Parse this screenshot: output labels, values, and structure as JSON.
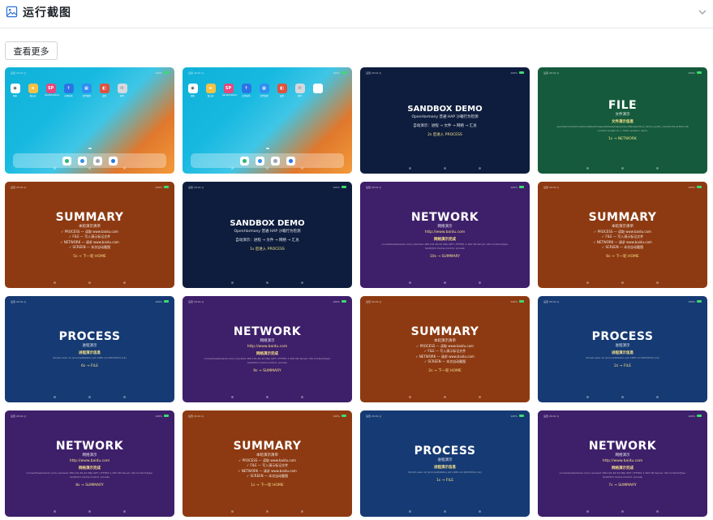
{
  "header": {
    "title": "运行截图",
    "icon": "image-icon",
    "collapse_icon": "chevron-down-icon"
  },
  "more_button": "查看更多",
  "status_bar": {
    "left": "设置 20:41 ◎",
    "right": "100%"
  },
  "desktop": {
    "apps": [
      {
        "label": "相机",
        "color": "#ffffff",
        "glyph": "◉",
        "glyph_color": "#444444"
      },
      {
        "label": "备忘录",
        "color": "#f6c143",
        "glyph": "≡",
        "glyph_color": "#ffffff"
      },
      {
        "label": "SandboxDemo",
        "color": "#e8467c",
        "glyph": "SP",
        "glyph_color": "#ffffff"
      },
      {
        "label": "应用市场",
        "color": "#2b74e6",
        "glyph": "↑",
        "glyph_color": "#ffffff"
      },
      {
        "label": "文件管理",
        "color": "#2f8ef0",
        "glyph": "▦",
        "glyph_color": "#ffffff"
      },
      {
        "label": "设置",
        "color": "#e0523e",
        "glyph": "◧",
        "glyph_color": "#ffffff"
      },
      {
        "label": "邮件",
        "color": "#d6d9de",
        "glyph": "✉",
        "glyph_color": "#7a7f87"
      }
    ],
    "apps_2": [
      {
        "label": "相机",
        "color": "#ffffff",
        "glyph": "◉",
        "glyph_color": "#444444"
      },
      {
        "label": "备忘录",
        "color": "#f6c143",
        "glyph": "≡",
        "glyph_color": "#ffffff"
      },
      {
        "label": "SandboxDemo",
        "color": "#e8467c",
        "glyph": "SP",
        "glyph_color": "#ffffff"
      },
      {
        "label": "应用市场",
        "color": "#2b74e6",
        "glyph": "↑",
        "glyph_color": "#ffffff"
      },
      {
        "label": "文件管理",
        "color": "#2f8ef0",
        "glyph": "▦",
        "glyph_color": "#ffffff"
      },
      {
        "label": "设置",
        "color": "#e0523e",
        "glyph": "◧",
        "glyph_color": "#ffffff"
      },
      {
        "label": "邮件",
        "color": "#d6d9de",
        "glyph": "✉",
        "glyph_color": "#7a7f87"
      },
      {
        "label": "",
        "color": "#ffffff",
        "glyph": "",
        "glyph_color": "#ffffff"
      }
    ],
    "dock": [
      "#2bb673",
      "#2f8ef0",
      "#9aa3ad",
      "#2b74e6"
    ]
  },
  "screenshots": [
    {
      "kind": "desktop",
      "apps_key": "apps"
    },
    {
      "kind": "desktop",
      "apps_key": "apps_2"
    },
    {
      "kind": "sandbox",
      "color": "c-navy",
      "title": "SANDBOX DEMO",
      "subtitle": "OpenHarmony 普通 HAP 沙箱行为检测",
      "flow": "自动演示：进程 → 文件 → 网络 → 汇总",
      "foot": "2s 后进入 PROCESS"
    },
    {
      "kind": "file",
      "color": "c-green",
      "title": "FILE",
      "subtitle": "文件演示",
      "section": "文件演示信息",
      "detail": "openharmonal/ah public/data/storage/el2/base/haps/entry/files/sandbox_demo_public_marker.txt written OK content length ok > Hello sandbox demo",
      "foot": "1s → NETWORK"
    },
    {
      "kind": "summary",
      "color": "c-orange",
      "title": "SUMMARY",
      "subtitle": "本轮演示清单",
      "items": [
        "✓ PROCESS — 读取 www.baidu.com",
        "✓ FILE — 写入演示标记文件",
        "✓ NETWORK — 请求 www.baidu.com",
        "✓ SCREEN — 本次自动截图"
      ],
      "foot": "5s → 下一轮 HOME"
    },
    {
      "kind": "sandbox",
      "color": "c-navy",
      "title": "SANDBOX DEMO",
      "subtitle": "OpenHarmony 普通 HAP 沙箱行为检测",
      "flow": "自动演示：进程 → 文件 → 网络 → 汇总",
      "foot": "1s 后进入 PROCESS"
    },
    {
      "kind": "network",
      "color": "c-purple",
      "title": "NETWORK",
      "subtitle": "网络演示",
      "url": "http://www.baidu.com",
      "section": "网络演示完成",
      "detail": "connect(www.baidu.com) resolved 180.101.49.44 http GET / HTTP/1.1 200 OK Server: bfe Content-Type: text/html Cache-Control: private",
      "foot": "10s → SUMMARY"
    },
    {
      "kind": "summary",
      "color": "c-orange",
      "title": "SUMMARY",
      "subtitle": "本轮演示清单",
      "items": [
        "✓ PROCESS — 读取 www.baidu.com",
        "✓ FILE — 写入演示标记文件",
        "✓ NETWORK — 请求 www.baidu.com",
        "✓ SCREEN — 本次自动截图"
      ],
      "foot": "6s → 下一轮 HOME"
    },
    {
      "kind": "process",
      "color": "c-blue",
      "title": "PROCESS",
      "subtitle": "进程演示",
      "section": "进程演示信息",
      "detail": "/bin/sh exec ok /proc/self/status pid 1489 uid 20010044 (ok)",
      "foot": "6s → FILE"
    },
    {
      "kind": "network",
      "color": "c-purple",
      "title": "NETWORK",
      "subtitle": "网络演示",
      "url": "http://www.baidu.com",
      "section": "网络演示完成",
      "detail": "connect(www.baidu.com) resolved 180.101.49.44 http GET / HTTP/1.1 200 OK Server: bfe Content-Type: text/html Cache-Control: private",
      "foot": "9s → SUMMARY"
    },
    {
      "kind": "summary",
      "color": "c-orange",
      "title": "SUMMARY",
      "subtitle": "本轮演示清单",
      "items": [
        "✓ PROCESS — 读取 www.baidu.com",
        "✓ FILE — 写入演示标记文件",
        "✓ NETWORK — 请求 www.baidu.com",
        "✓ SCREEN — 本次自动截图"
      ],
      "foot": "2s → 下一轮 HOME"
    },
    {
      "kind": "process",
      "color": "c-blue",
      "title": "PROCESS",
      "subtitle": "进程演示",
      "section": "进程演示信息",
      "detail": "/bin/sh exec ok /proc/self/status pid 1489 uid 20010044 (ok)",
      "foot": "2s → FILE"
    },
    {
      "kind": "network",
      "color": "c-purple",
      "title": "NETWORK",
      "subtitle": "网络演示",
      "url": "http://www.baidu.com",
      "section": "网络演示完成",
      "detail": "connect(www.baidu.com) resolved 180.101.49.44 http GET / HTTP/1.1 200 OK Server: bfe Content-Type: text/html Cache-Control: private",
      "foot": "8s → SUMMARY"
    },
    {
      "kind": "summary",
      "color": "c-orange",
      "title": "SUMMARY",
      "subtitle": "本轮演示清单",
      "items": [
        "✓ PROCESS — 读取 www.baidu.com",
        "✓ FILE — 写入演示标记文件",
        "✓ NETWORK — 请求 www.baidu.com",
        "✓ SCREEN — 本次自动截图"
      ],
      "foot": "1s → 下一轮 HOME"
    },
    {
      "kind": "process",
      "color": "c-blue",
      "title": "PROCESS",
      "subtitle": "进程演示",
      "section": "进程演示信息",
      "detail": "/bin/sh exec ok /proc/self/status pid 1489 uid 20010044 (ok)",
      "foot": "1s → FILE"
    },
    {
      "kind": "network",
      "color": "c-purple",
      "title": "NETWORK",
      "subtitle": "网络演示",
      "url": "http://www.baidu.com",
      "section": "网络演示完成",
      "detail": "connect(www.baidu.com) resolved 180.101.49.44 http GET / HTTP/1.1 200 OK Server: bfe Content-Type: text/html Cache-Control: private",
      "foot": "7s → SUMMARY"
    }
  ]
}
